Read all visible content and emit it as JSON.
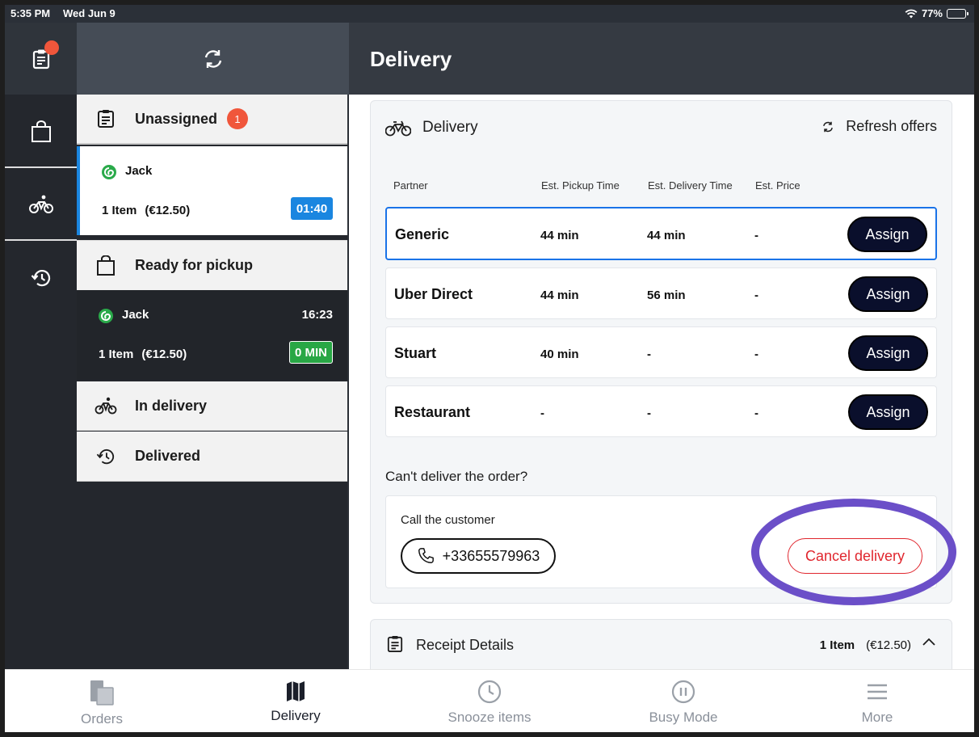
{
  "status_bar": {
    "time": "5:35 PM",
    "date": "Wed Jun 9",
    "battery": "77%",
    "battery_level": 0.77
  },
  "header": {
    "title": "Delivery"
  },
  "sidebar": {
    "icons": [
      "clipboard-icon",
      "shopping-bag-icon",
      "bicycle-icon",
      "history-icon"
    ]
  },
  "order_list": {
    "sections": {
      "unassigned": {
        "label": "Unassigned",
        "badge": "1"
      },
      "ready": {
        "label": "Ready for pickup"
      },
      "in_delivery": {
        "label": "In delivery"
      },
      "delivered": {
        "label": "Delivered"
      }
    },
    "orders": [
      {
        "name": "Jack",
        "items": "1 Item",
        "price": "(€12.50)",
        "pill": "01:40",
        "pill_color": "#1a86e0",
        "time": ""
      },
      {
        "name": "Jack",
        "items": "1 Item",
        "price": "(€12.50)",
        "pill": "0 MIN",
        "pill_color": "#28a745",
        "time": "16:23"
      }
    ]
  },
  "delivery": {
    "title": "Delivery",
    "refresh_label": "Refresh offers",
    "columns": [
      "Partner",
      "Est. Pickup Time",
      "Est. Delivery Time",
      "Est. Price"
    ],
    "partners": [
      {
        "name": "Generic",
        "pickup": "44 min",
        "delivery": "44 min",
        "price": "-",
        "action": "Assign"
      },
      {
        "name": "Uber Direct",
        "pickup": "44 min",
        "delivery": "56 min",
        "price": "-",
        "action": "Assign"
      },
      {
        "name": "Stuart",
        "pickup": "40 min",
        "delivery": "-",
        "price": "-",
        "action": "Assign"
      },
      {
        "name": "Restaurant",
        "pickup": "-",
        "delivery": "-",
        "price": "-",
        "action": "Assign"
      }
    ],
    "cant_deliver": "Can't deliver the order?",
    "call_label": "Call the customer",
    "phone": "+33655579963",
    "cancel_label": "Cancel delivery"
  },
  "receipt": {
    "title": "Receipt Details",
    "items": "1 Item",
    "price": "(€12.50)"
  },
  "tabs": [
    {
      "label": "Orders",
      "icon": "orders-icon"
    },
    {
      "label": "Delivery",
      "icon": "map-icon"
    },
    {
      "label": "Snooze items",
      "icon": "clock-icon"
    },
    {
      "label": "Busy Mode",
      "icon": "pause-icon"
    },
    {
      "label": "More",
      "icon": "menu-icon"
    }
  ],
  "colors": {
    "accent_blue": "#1a73e8",
    "badge_red": "#f0563b",
    "assign_bg": "#0a0f2c",
    "cancel_red": "#e0262e",
    "highlight_ring": "#6b4fc8"
  }
}
